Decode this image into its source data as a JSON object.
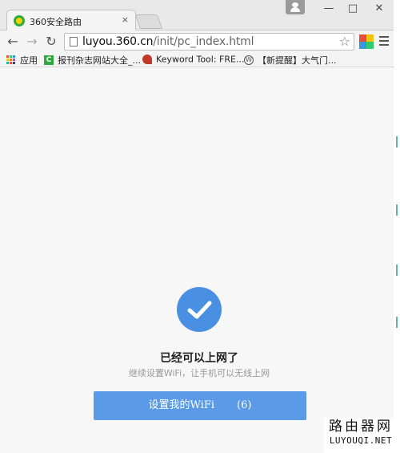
{
  "tab": {
    "title": "360安全路由",
    "close": "×"
  },
  "window_controls": {
    "minimize": "—",
    "maximize": "□",
    "close": "✕"
  },
  "toolbar": {
    "back": "←",
    "forward": "→",
    "reload": "↻",
    "url_host": "luyou.360.cn",
    "url_path": "/init/pc_index.html",
    "star": "☆"
  },
  "bookmarks": [
    {
      "label": "应用",
      "icon": "apps-grid-icon"
    },
    {
      "label": "报刊杂志网站大全_...",
      "icon": "green-c-icon"
    },
    {
      "label": "Keyword Tool: FRE...",
      "icon": "keyword-tool-icon"
    },
    {
      "label": "【新提醒】大气门...",
      "icon": "wordpress-icon"
    }
  ],
  "main": {
    "status_icon": "check-circle-icon",
    "title": "已经可以上网了",
    "subtitle": "继续设置WiFi，让手机可以无线上网",
    "button_label": "设置我的WiFi",
    "button_countdown": "(6)"
  },
  "watermark": {
    "cn": "路由器网",
    "en": "LUYOUQI.NET"
  },
  "colors": {
    "accent": "#4a90e2",
    "button": "#5b9ae6"
  }
}
